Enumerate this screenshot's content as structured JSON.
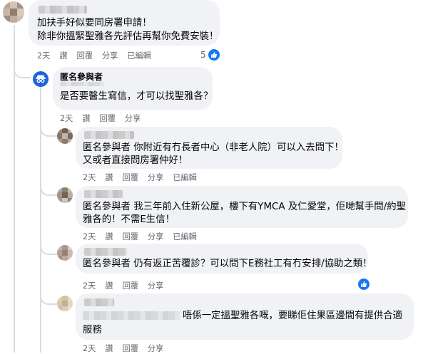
{
  "comment1": {
    "line1": "加扶手好似要同房署申請！",
    "line2": "除非你搵緊聖雅各先評估再幫你免費安裝！",
    "actions": [
      "2天",
      "讚",
      "回覆",
      "分享",
      "已編輯"
    ],
    "reaction_count": "5"
  },
  "reply_anon": {
    "name": "匿名參與者",
    "text": "是否要醫生寫信，才可以找聖雅各？",
    "actions": [
      "2天",
      "讚",
      "回覆",
      "分享"
    ]
  },
  "reply2": {
    "line1": "匿名參與者 你附近有冇長者中心（非老人院）可以入去問下！",
    "line2": "又或者直接問房署仲好！",
    "actions": [
      "2天",
      "讚",
      "回覆",
      "分享",
      "已編輯"
    ]
  },
  "reply3": {
    "line1": "匿名參與者 我三年前入住新公屋，樓下有YMCA 及仁愛堂，佢哋幫手問/約聖",
    "line2": "雅各的！不需E生信！",
    "actions": [
      "2天",
      "讚",
      "回覆",
      "分享",
      "已編輯"
    ]
  },
  "reply4": {
    "line1": "匿名參與者 仍有返正苦覆診？可以問下E務社工有冇安排/協助之類！",
    "actions": [
      "2天",
      "讚",
      "回覆",
      "分享"
    ]
  },
  "reply5": {
    "line1": "唔係一定搵聖雅各嘅，要睇佢住果區邊間有提供合適",
    "line2": "服務",
    "actions": [
      "2天",
      "讚",
      "回覆",
      "分享"
    ]
  },
  "icons": {
    "like": "thumbs-up-icon",
    "anonymous": "anonymous-participant-icon"
  },
  "colors": {
    "bubble": "#f0f2f5",
    "like_blue": "#1877f2",
    "meta_text": "#65676b"
  }
}
